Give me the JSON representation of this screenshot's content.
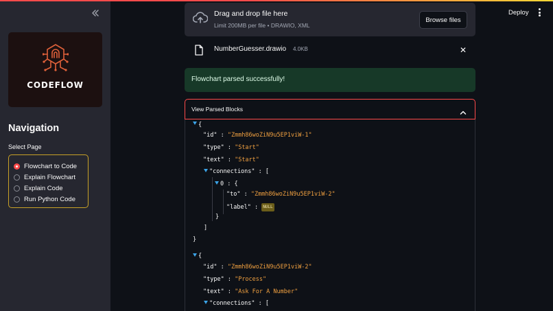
{
  "sidebar": {
    "logo_text": "CODEFLOW",
    "nav_title": "Navigation",
    "select_label": "Select Page",
    "pages": [
      {
        "label": "Flowchart to Code",
        "selected": true
      },
      {
        "label": "Explain Flowchart",
        "selected": false
      },
      {
        "label": "Explain Code",
        "selected": false
      },
      {
        "label": "Run Python Code",
        "selected": false
      }
    ]
  },
  "header": {
    "deploy_label": "Deploy"
  },
  "uploader": {
    "title": "Drag and drop file here",
    "limit": "Limit 200MB per file • DRAWIO, XML",
    "browse_label": "Browse files"
  },
  "file": {
    "name": "NumberGuesser.drawio",
    "size": "4.0KB"
  },
  "success_message": "Flowchart parsed successfully!",
  "expander": {
    "label": "View Parsed Blocks",
    "expanded": true
  },
  "blocks": [
    {
      "id": "\"Zmmh86woZiN9u5EP1viW-1\"",
      "type": "\"Start\"",
      "text": "\"Start\"",
      "connection": {
        "index": "0",
        "to": "\"Zmmh86woZiN9u5EP1viW-2\"",
        "label": "NULL"
      }
    },
    {
      "id": "\"Zmmh86woZiN9u5EP1viW-2\"",
      "type": "\"Process\"",
      "text": "\"Ask For A Number\""
    }
  ],
  "json_keys": {
    "id": "\"id\"",
    "type": "\"type\"",
    "text": "\"text\"",
    "connections": "\"connections\"",
    "to": "\"to\"",
    "label": "\"label\""
  },
  "json_punct": {
    "open_obj": "{",
    "close_obj": "}",
    "open_arr": "[",
    "close_arr": "]",
    "colon": " : "
  },
  "colors": {
    "accent": "#ff4b4b",
    "string_value": "#f0a040",
    "success_bg": "#173928",
    "radio_border": "#c9a227"
  },
  "icons": [
    "collapse-sidebar-icon",
    "cloud-upload-icon",
    "file-icon",
    "close-icon",
    "chevron-up-icon",
    "kebab-menu-icon",
    "tree-toggle-icon"
  ]
}
